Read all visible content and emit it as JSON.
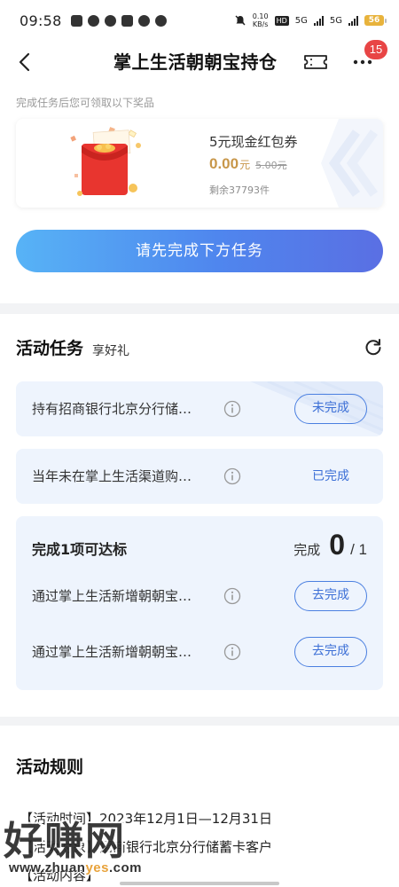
{
  "status_bar": {
    "time": "09:58",
    "net_speed": "0.10",
    "net_unit": "KB/s",
    "hd_label": "HD",
    "sim1_label": "5G",
    "sim2_label": "5G",
    "battery": "56"
  },
  "nav": {
    "title": "掌上生活朝朝宝持仓",
    "badge_count": "15"
  },
  "reward": {
    "hint": "完成任务后您可领取以下奖品",
    "name": "5元现金红包券",
    "price": "0.00",
    "price_unit": "元",
    "original_price": "5.00元",
    "stock": "剩余37793件",
    "main_button": "请先完成下方任务"
  },
  "tasks": {
    "title": "活动任务",
    "subtitle": "享好礼",
    "items": [
      {
        "text": "持有招商银行北京分行储…",
        "status": "未完成"
      },
      {
        "text": "当年未在掌上生活渠道购…",
        "status": "已完成"
      }
    ],
    "group": {
      "title": "完成1项可达标",
      "progress_label": "完成",
      "progress_done": "0",
      "progress_total": "/ 1",
      "items": [
        {
          "text": "通过掌上生活新增朝朝宝…",
          "status": "去完成"
        },
        {
          "text": "通过掌上生活新增朝朝宝…",
          "status": "去完成"
        }
      ]
    }
  },
  "rules": {
    "title": "活动规则",
    "lines": [
      "【活动时间】2023年12月1日—12月31日",
      "【活动对象】招商银行北京分行储蓄卡客户",
      "【活动内容】"
    ]
  },
  "watermark": {
    "text": "好赚网",
    "url_prefix": "www.zhuan",
    "url_accent": "yes",
    "url_suffix": ".com"
  },
  "colors": {
    "accent_blue": "#4f86ee",
    "price_gold": "#c8974a",
    "badge_red": "#e84545",
    "battery_yellow": "#e8b33c"
  },
  "icons": [
    "back-arrow-icon",
    "ticket-icon",
    "more-icon",
    "refresh-icon",
    "info-icon",
    "red-envelope-icon"
  ]
}
